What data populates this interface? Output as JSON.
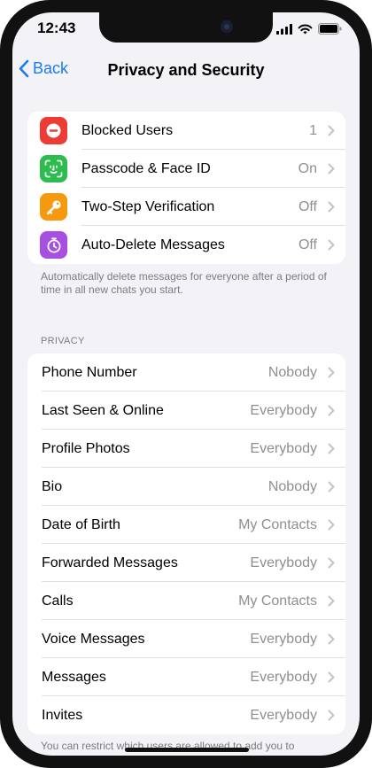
{
  "status": {
    "time": "12:43"
  },
  "nav": {
    "back_label": "Back",
    "title": "Privacy and Security"
  },
  "security_items": [
    {
      "label": "Blocked Users",
      "value": "1",
      "icon": "minus-circle-icon",
      "color": "#ef3b35"
    },
    {
      "label": "Passcode & Face ID",
      "value": "On",
      "icon": "face-id-icon",
      "color": "#2dbd4e"
    },
    {
      "label": "Two-Step Verification",
      "value": "Off",
      "icon": "key-icon",
      "color": "#f59a0e"
    },
    {
      "label": "Auto-Delete Messages",
      "value": "Off",
      "icon": "timer-icon",
      "color": "#a64fe0"
    }
  ],
  "auto_delete_footer": "Automatically delete messages for everyone after a period of time in all new chats you start.",
  "privacy_header": "PRIVACY",
  "privacy_items": [
    {
      "label": "Phone Number",
      "value": "Nobody"
    },
    {
      "label": "Last Seen & Online",
      "value": "Everybody"
    },
    {
      "label": "Profile Photos",
      "value": "Everybody"
    },
    {
      "label": "Bio",
      "value": "Nobody"
    },
    {
      "label": "Date of Birth",
      "value": "My Contacts"
    },
    {
      "label": "Forwarded Messages",
      "value": "Everybody"
    },
    {
      "label": "Calls",
      "value": "My Contacts"
    },
    {
      "label": "Voice Messages",
      "value": "Everybody"
    },
    {
      "label": "Messages",
      "value": "Everybody"
    },
    {
      "label": "Invites",
      "value": "Everybody"
    }
  ],
  "privacy_footer": "You can restrict which users are allowed to add you to",
  "colors": {
    "accent": "#1a7cf5",
    "background": "#f2f2f7",
    "secondary_text": "#8e8e93"
  }
}
